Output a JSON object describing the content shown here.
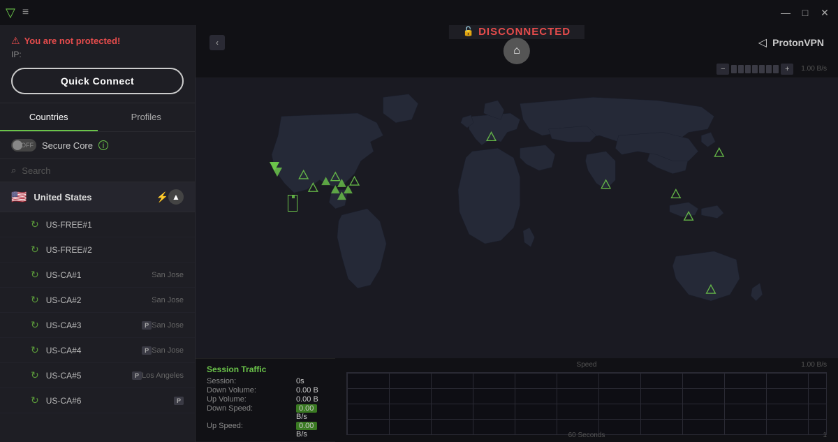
{
  "titlebar": {
    "logo": "▽",
    "menu": "≡",
    "minimize": "—",
    "maximize": "□",
    "close": "✕"
  },
  "sidebar": {
    "protection": {
      "icon": "⚠",
      "text": "You are not protected!",
      "ip_label": "IP:"
    },
    "quick_connect_label": "Quick Connect",
    "tabs": [
      {
        "id": "countries",
        "label": "Countries",
        "active": true
      },
      {
        "id": "profiles",
        "label": "Profiles",
        "active": false
      }
    ],
    "secure_core": {
      "label": "Secure Core",
      "toggle_state": "OFF"
    },
    "search_placeholder": "Search",
    "countries": [
      {
        "name": "United States",
        "flag": "🇺🇸",
        "expanded": true,
        "servers": [
          {
            "id": "US-FREE#1",
            "location": "",
            "plus": false
          },
          {
            "id": "US-FREE#2",
            "location": "",
            "plus": false
          },
          {
            "id": "US-CA#1",
            "location": "San Jose",
            "plus": true
          },
          {
            "id": "US-CA#2",
            "location": "San Jose",
            "plus": true
          },
          {
            "id": "US-CA#3",
            "location": "San Jose",
            "plus": true
          },
          {
            "id": "US-CA#4",
            "location": "San Jose",
            "plus": true
          },
          {
            "id": "US-CA#5",
            "location": "Los Angeles",
            "plus": true
          },
          {
            "id": "US-CA#6",
            "location": "",
            "plus": true
          }
        ]
      }
    ]
  },
  "header": {
    "collapse_icon": "‹",
    "status": "DISCONNECTED",
    "home_icon": "⌂",
    "brand_icon": "◁",
    "brand_name": "ProtonVPN"
  },
  "speed": {
    "minus": "−",
    "plus": "+",
    "value": "1.00 B/s"
  },
  "stats": {
    "title": "Session Traffic",
    "session_label": "Session:",
    "session_value": "0s",
    "down_vol_label": "Down Volume:",
    "down_vol_value": "0.00",
    "down_vol_unit": "B",
    "up_vol_label": "Up Volume:",
    "up_vol_value": "0.00",
    "up_vol_unit": "B",
    "down_speed_label": "Down Speed:",
    "down_speed_value": "0.00",
    "down_speed_unit": "B/s",
    "up_speed_label": "Up Speed:",
    "up_speed_value": "0.00",
    "up_speed_unit": "B/s"
  },
  "graph": {
    "speed_label": "Speed",
    "right_label": "1.00 B/s",
    "time_label": "60 Seconds",
    "bottom_right": "1"
  },
  "colors": {
    "accent_green": "#6bc44a",
    "danger_red": "#e64c4c",
    "bg_dark": "#111115",
    "bg_mid": "#1e1e24"
  }
}
